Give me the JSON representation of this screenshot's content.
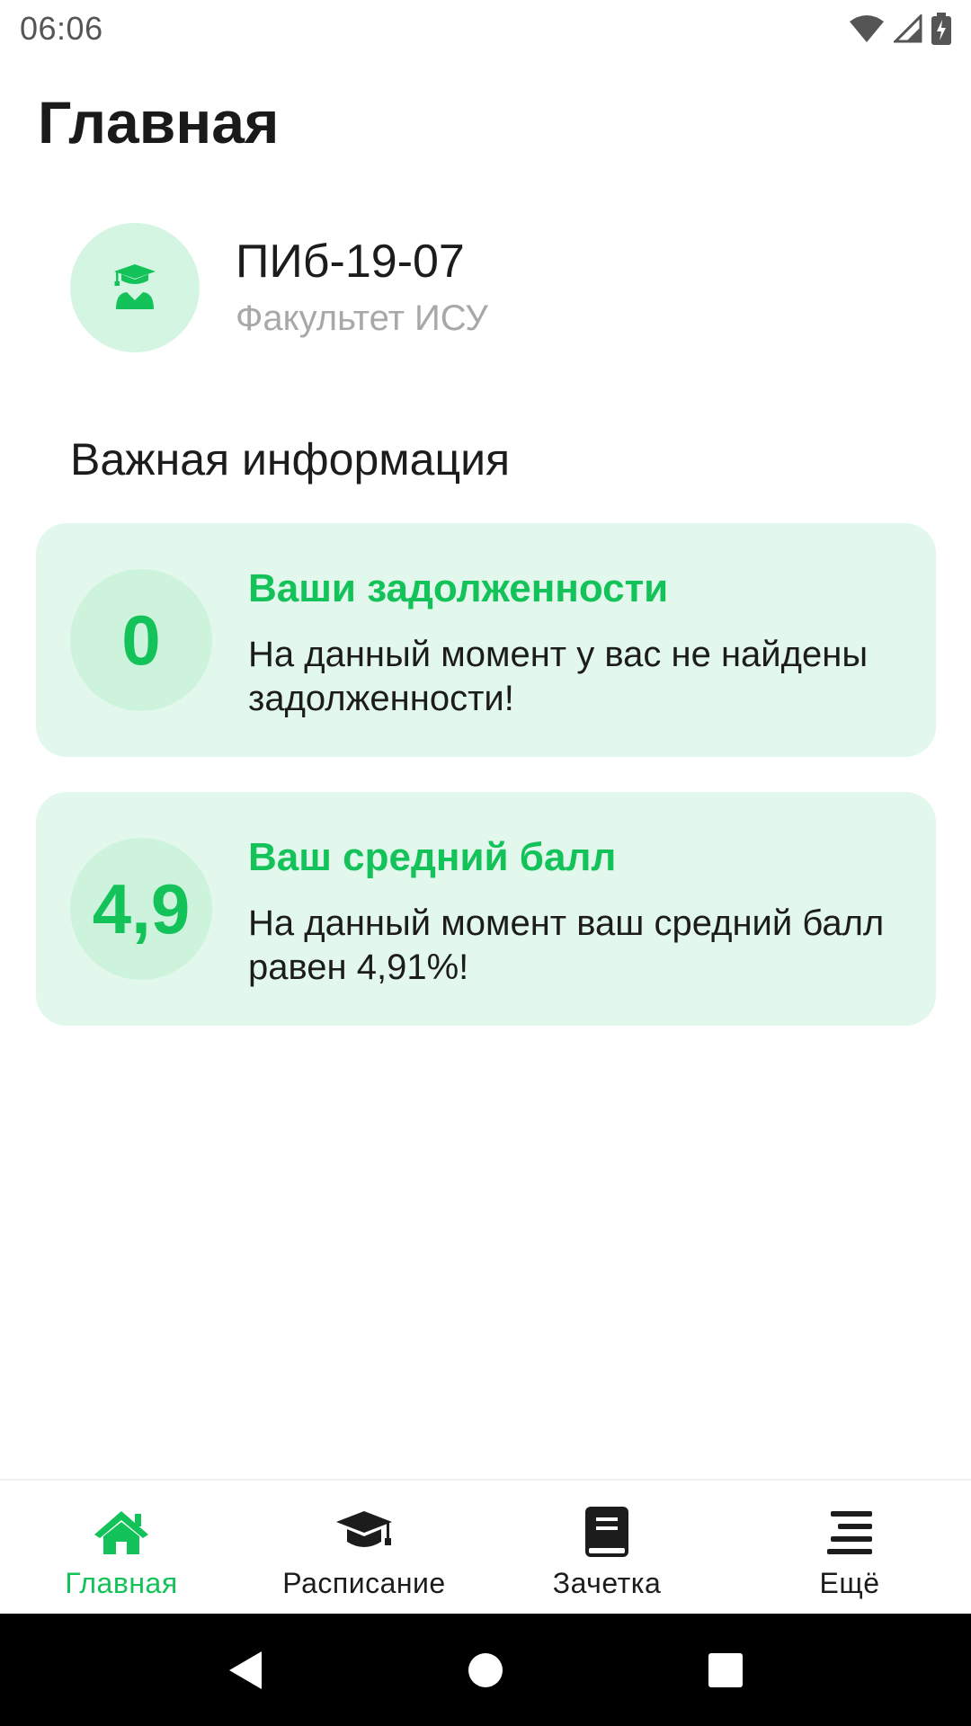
{
  "status_bar": {
    "time": "06:06",
    "icons": [
      "wifi-icon",
      "signal-icon",
      "battery-charging-icon"
    ]
  },
  "page": {
    "title": "Главная"
  },
  "group": {
    "icon": "student-graduate-icon",
    "name": "ПИб-19-07",
    "faculty": "Факультет ИСУ"
  },
  "section_title": "Важная информация",
  "cards": [
    {
      "badge": "0",
      "title": "Ваши задолженности",
      "text": "На данный момент у вас не найдены задолженности!"
    },
    {
      "badge": "4,9",
      "title": "Ваш средний балл",
      "text": "На данный момент ваш средний балл равен 4,91%!"
    }
  ],
  "bottom_nav": {
    "items": [
      {
        "label": "Главная",
        "icon": "home-icon",
        "active": true
      },
      {
        "label": "Расписание",
        "icon": "graduation-cap-icon",
        "active": false
      },
      {
        "label": "Зачетка",
        "icon": "book-icon",
        "active": false
      },
      {
        "label": "Ещё",
        "icon": "menu-lines-icon",
        "active": false
      }
    ]
  },
  "system_nav": {
    "buttons": [
      "back-icon",
      "home-circle-icon",
      "recents-square-icon"
    ]
  },
  "colors": {
    "accent": "#14c25a",
    "card_bg": "#e3f8ec",
    "badge_bg": "#cdf3dd",
    "text": "#1c1c1c",
    "muted": "#a8a8a8"
  }
}
